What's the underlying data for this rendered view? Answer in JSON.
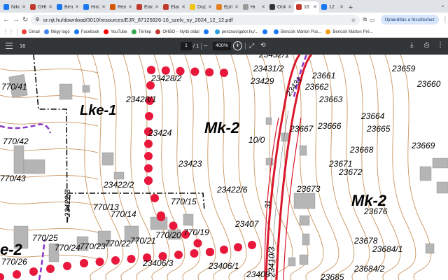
{
  "tabs": [
    {
      "label": "Niko",
      "color": "#1877f2"
    },
    {
      "label": "OHB",
      "color": "#c0392b"
    },
    {
      "label": "Benc",
      "color": "#1877f2"
    },
    {
      "label": "Hird",
      "color": "#1877f2"
    },
    {
      "label": "Rea",
      "color": "#d35400"
    },
    {
      "label": "Elad",
      "color": "#c0392b"
    },
    {
      "label": "Elad",
      "color": "#c0392b"
    },
    {
      "label": "Dup",
      "color": "#f1c40f"
    },
    {
      "label": "Épít",
      "color": "#e67e22"
    },
    {
      "label": "Hi",
      "color": "#999999"
    },
    {
      "label": "Önk",
      "color": "#333333"
    },
    {
      "label": "16",
      "color": "#c0392b",
      "active": true
    },
    {
      "label": "12",
      "color": "#1877f2"
    }
  ],
  "address": {
    "url": "or.njt.hu/download/3010/resources/EJR_87125826-16_szelv_ny_2024_12_12.pdf",
    "restart_label": "Újraindítás a frissítéshez"
  },
  "bookmarks": [
    {
      "label": "Gmail",
      "color": "#ea4335"
    },
    {
      "label": "Négy logó",
      "color": "#4285f4"
    },
    {
      "label": "Facebook",
      "color": "#1877f2"
    },
    {
      "label": "YouTube",
      "color": "#ff0000"
    },
    {
      "label": "Térkép",
      "color": "#34a853"
    },
    {
      "label": "OHBO – Nyitó oldal",
      "color": "#c0392b"
    },
    {
      "label": "",
      "color": "#1877f2"
    },
    {
      "label": "penznavigator.hu/...",
      "color": "#2d9cdb"
    },
    {
      "label": "",
      "color": "#1877f2"
    },
    {
      "label": "Bencsik Márton Pos...",
      "color": "#1877f2"
    },
    {
      "label": "Bencsik Márton Pré...",
      "color": "#f39c12"
    }
  ],
  "pdf": {
    "title": "16",
    "page": "1",
    "page_total": "/ 1",
    "zoom": "400%"
  },
  "map": {
    "zones": [
      "Lke-1",
      "Mk-2",
      "Mk-2",
      "e-2"
    ],
    "parcels": [
      "770/41",
      "23432/1",
      "23431/2",
      "23661",
      "23659",
      "23662",
      "23660",
      "23428/2",
      "23429",
      "23663",
      "23428/1",
      "23664",
      "23665",
      "23667",
      "23666",
      "770/42",
      "23424",
      "10/0",
      "23668",
      "23669",
      "23671",
      "23672",
      "23423",
      "770/43",
      "23422/2",
      "23422/6",
      "23673",
      "770/13",
      "770/15",
      "23676",
      "770/14",
      "23407",
      "770/19",
      "770/20",
      "23678",
      "770/25",
      "770/24",
      "770/23",
      "770/22",
      "770/21",
      "23684/1",
      "23406/3",
      "23406/1",
      "770/26",
      "23684/2",
      "23409",
      "23685",
      "31",
      "23410/3",
      "23422/3",
      "23431"
    ],
    "colors": {
      "zone_red": "#d8182a",
      "dot_red": "#e8183c",
      "purple": "#8b35c8",
      "contour": "#c99560"
    }
  }
}
